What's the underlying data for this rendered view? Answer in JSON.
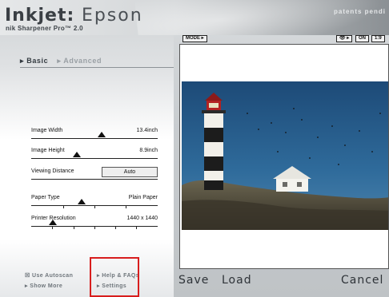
{
  "header": {
    "title_bold": "Inkjet:",
    "title_light": "Epson",
    "subtitle": "nik Sharpener Pro™ 2.0",
    "brand": "patents pendi"
  },
  "tabs": {
    "basic": "Basic",
    "advanced": "Advanced"
  },
  "controls": {
    "image_width": {
      "label": "Image Width",
      "value": "13.4inch",
      "level": 0.56
    },
    "image_height": {
      "label": "Image Height",
      "value": "8.9inch",
      "level": 0.36
    },
    "viewing_distance": {
      "label": "Viewing Distance",
      "button": "Auto"
    },
    "paper_type": {
      "label": "Paper Type",
      "value": "Plain Paper",
      "level": 0.4
    },
    "printer_resolution": {
      "label": "Printer Resolution",
      "value": "1440 x 1440",
      "level": 0.17
    }
  },
  "bottom_links": {
    "use_autoscan": "Use Autoscan",
    "show_more": "Show More",
    "help": "Help & FAQs",
    "settings": "Settings"
  },
  "preview_bar": {
    "mode": "MODE",
    "eye": "👁",
    "on": "ON",
    "zoom": "1:9"
  },
  "actions": {
    "save": "Save",
    "load": "Load",
    "cancel": "Cancel"
  },
  "colors": {
    "highlight": "#d81d1d",
    "sky": "#2d5f8f"
  }
}
